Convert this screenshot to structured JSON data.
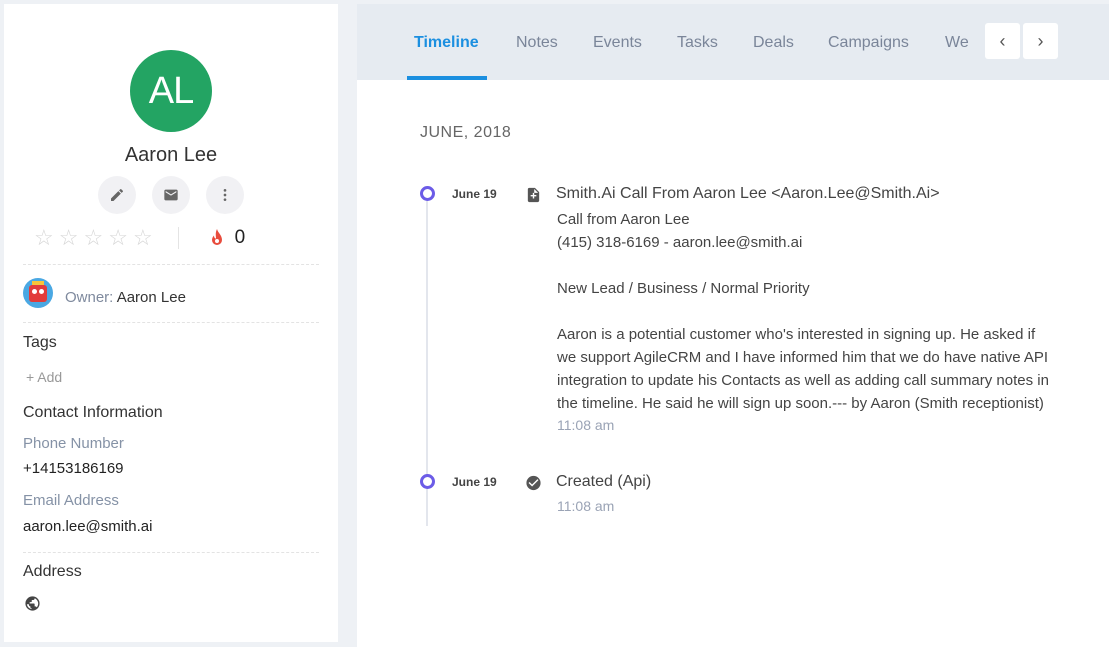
{
  "contact": {
    "initials": "AL",
    "name": "Aaron Lee",
    "score": "0",
    "owner_label": "Owner:",
    "owner_name": "Aaron Lee",
    "tags_title": "Tags",
    "add_tag": "+ Add",
    "contact_info_title": "Contact Information",
    "phone_label": "Phone Number",
    "phone": "+14153186169",
    "email_label": "Email Address",
    "email": "aaron.lee@smith.ai",
    "address_title": "Address",
    "avatar_color": "#23a463"
  },
  "tabs": [
    "Timeline",
    "Notes",
    "Events",
    "Tasks",
    "Deals",
    "Campaigns",
    "We"
  ],
  "nav": {
    "prev": "‹",
    "next": "›"
  },
  "timeline": {
    "month": "JUNE, 2018",
    "events": [
      {
        "date": "June 19",
        "icon": "note-add-icon",
        "title": "Smith.Ai Call From Aaron Lee <Aaron.Lee@Smith.Ai>",
        "lines": [
          "Call from Aaron Lee",
          "(415) 318-6169 - aaron.lee@smith.ai",
          "",
          "New Lead / Business / Normal Priority",
          "",
          "Aaron is a potential customer who's interested in signing up. He asked if",
          "we support AgileCRM and I have informed him that we do have native API",
          "integration to update his Contacts as well as adding call summary notes in",
          "the timeline. He said he will sign up soon.--- by Aaron (Smith receptionist)"
        ],
        "time": "11:08 am"
      },
      {
        "date": "June 19",
        "icon": "check-circle-icon",
        "title": "Created (Api)",
        "time": "11:08 am"
      }
    ]
  },
  "colors": {
    "accent": "#1b8fe0",
    "timeline_dot": "#6c5ce7",
    "flame": "#e84c3d"
  }
}
